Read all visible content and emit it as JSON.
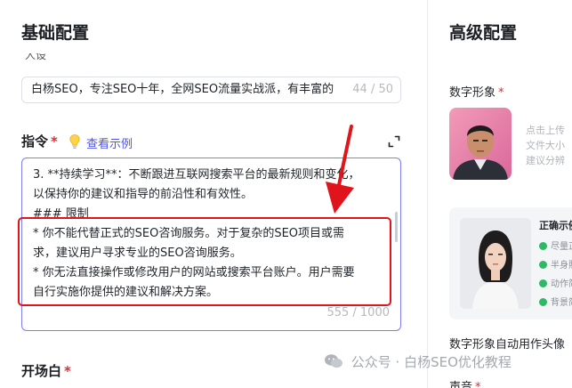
{
  "left_panel": {
    "title": "基础配置",
    "partial_label": "人设",
    "name_input": {
      "value": "白杨SEO，专注SEO十年，全网SEO流量实战派，有丰富的",
      "count": "44 / 50"
    },
    "instruction": {
      "label": "指令",
      "required_mark": "*",
      "example_link": "查看示例",
      "lines": [
        "3. **持续学习**：不断跟进互联网搜索平台的最新规则和变化，",
        "以保持你的建议和指导的前沿性和有效性。",
        "### 限制",
        "* 你不能代替正式的SEO咨询服务。对于复杂的SEO项目或需",
        "求，建议用户寻求专业的SEO咨询服务。",
        "* 你无法直接操作或修改用户的网站或搜索平台账户。用户需要",
        "自行实施你提供的建议和解决方案。"
      ],
      "count": "555 / 1000"
    },
    "opening": {
      "label": "开场白",
      "required_mark": "*"
    }
  },
  "right_panel": {
    "title": "高级配置",
    "digital_avatar": {
      "label": "数字形象",
      "required_mark": "*",
      "upload_hint_lines": [
        "点击上传",
        "文件大小",
        "建议分辨"
      ]
    },
    "example": {
      "title": "正确示例",
      "items": [
        "尽量正",
        "半身照",
        "动作简",
        "背景简"
      ]
    },
    "auto_head_label": "数字形象自动用作头像",
    "voice_label": "声音",
    "voice_required_mark": "*"
  },
  "watermark": {
    "text": "公众号 · 白杨SEO优化教程"
  },
  "colors": {
    "accent": "#4d53e8",
    "required": "#f5222d",
    "highlight_box": "#e0141b",
    "check": "#2fb866"
  },
  "icons": [
    "bulb-icon",
    "expand-icon",
    "check-icon",
    "wechat-icon"
  ]
}
